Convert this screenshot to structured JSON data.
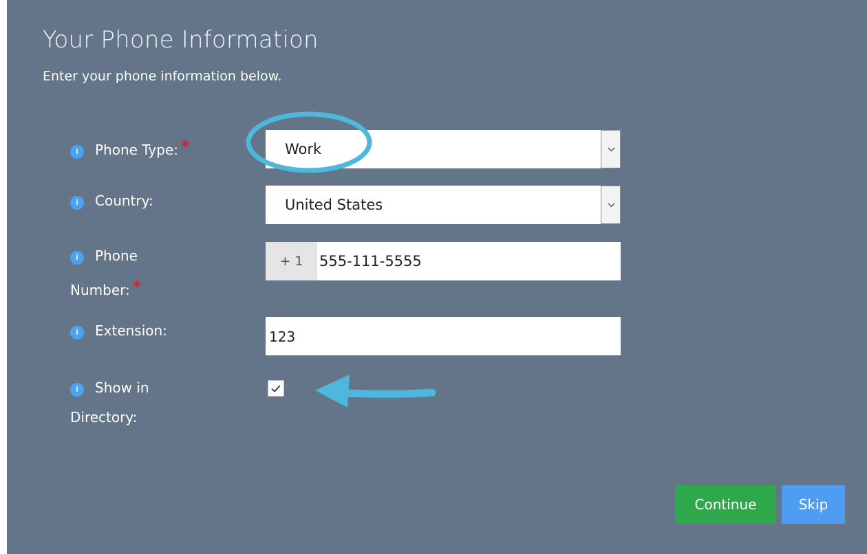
{
  "page": {
    "title": "Your Phone Information",
    "subtitle": "Enter your phone information below."
  },
  "form": {
    "phone_type": {
      "label": "Phone Type:",
      "required_mark": "*",
      "value": "Work"
    },
    "country": {
      "label": "Country:",
      "value": "United States"
    },
    "phone_number": {
      "label_line1": "Phone",
      "label_line2": "Number:",
      "required_mark": "*",
      "prefix": "+ 1",
      "value": "555-111-5555"
    },
    "extension": {
      "label": "Extension:",
      "value": "123"
    },
    "show_in_directory": {
      "label_line1": "Show in",
      "label_line2": "Directory:",
      "checked": true
    }
  },
  "actions": {
    "continue_label": "Continue",
    "skip_label": "Skip"
  },
  "icons": {
    "info": "info-icon",
    "dropdown": "chevron-down-icon",
    "check": "check-icon"
  },
  "colors": {
    "panel_background": "#64758a",
    "continue_button": "#2ea84a",
    "skip_button": "#4d9ef2",
    "required_mark": "#d9202d",
    "info_icon": "#4aa3f0",
    "annotation": "#4db8dc"
  }
}
